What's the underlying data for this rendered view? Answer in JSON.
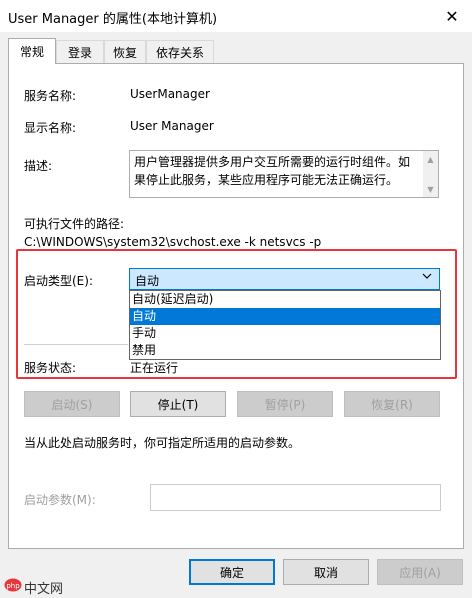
{
  "window": {
    "title": "User Manager 的属性(本地计算机)",
    "close_glyph": "✕"
  },
  "tabs": [
    {
      "label": "常规",
      "active": true
    },
    {
      "label": "登录",
      "active": false
    },
    {
      "label": "恢复",
      "active": false
    },
    {
      "label": "依存关系",
      "active": false
    }
  ],
  "general": {
    "service_name_label": "服务名称:",
    "service_name_value": "UserManager",
    "display_name_label": "显示名称:",
    "display_name_value": "User Manager",
    "description_label": "描述:",
    "description_value": "用户管理器提供多用户交互所需要的运行时组件。如果停止此服务，某些应用程序可能无法正确运行。",
    "exe_path_label": "可执行文件的路径:",
    "exe_path_value": "C:\\WINDOWS\\system32\\svchost.exe -k netsvcs -p",
    "startup_type_label": "启动类型(E):",
    "startup_type_value": "自动",
    "startup_options": [
      "自动(延迟启动)",
      "自动",
      "手动",
      "禁用"
    ],
    "startup_selected_index": 1,
    "service_status_label": "服务状态:",
    "service_status_value": "正在运行",
    "buttons": {
      "start": "启动(S)",
      "stop": "停止(T)",
      "pause": "暂停(P)",
      "resume": "恢复(R)"
    },
    "hint_text": "当从此处启动服务时，你可指定所适用的启动参数。",
    "start_params_label": "启动参数(M):",
    "start_params_value": ""
  },
  "footer": {
    "ok": "确定",
    "cancel": "取消",
    "apply": "应用(A)"
  },
  "watermark": {
    "text": "中文网",
    "icon": "php-logo-icon"
  },
  "colors": {
    "accent": "#0078d7",
    "highlight_box": "#e8353a",
    "watermark_red": "#e4393c"
  }
}
